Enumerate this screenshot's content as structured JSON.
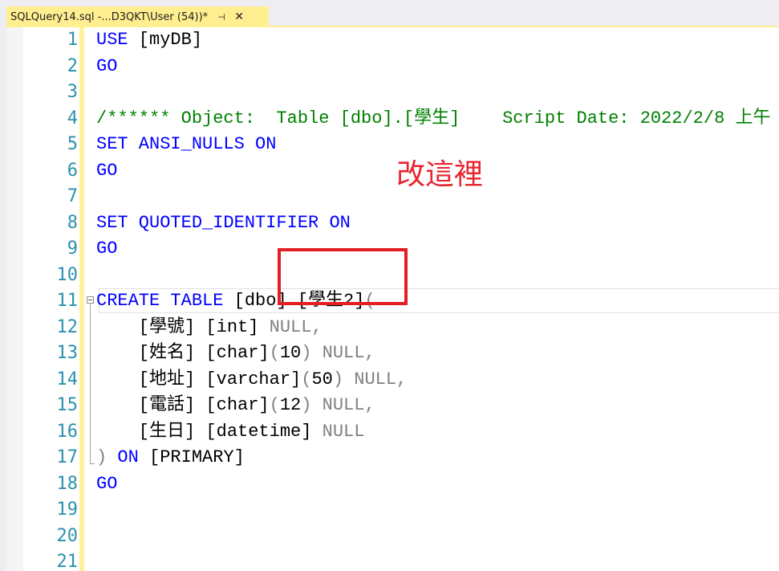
{
  "tab": {
    "title": "SQLQuery14.sql -...D3QKT\\User (54))*",
    "pin_glyph": "⊣",
    "close_glyph": "✕",
    "icons": [
      "pin-icon",
      "close-icon"
    ]
  },
  "colors": {
    "tab_active": "#ffef91",
    "keyword": "#0000ff",
    "comment": "#008000",
    "gray": "#808080",
    "line_number": "#2b91af",
    "annotation": "#e8242e"
  },
  "line_numbers": [
    "1",
    "2",
    "3",
    "4",
    "5",
    "6",
    "7",
    "8",
    "9",
    "10",
    "11",
    "12",
    "13",
    "14",
    "15",
    "16",
    "17",
    "18",
    "19",
    "20",
    "21"
  ],
  "code": {
    "l1_kw": "USE",
    "l1_rest": " [myDB]",
    "l2_kw": "GO",
    "l4_comment": "/****** Object:  Table [dbo].[學生]    Script Date: 2022/2/8 上午",
    "l5_kw": "SET ANSI_NULLS ON",
    "l6_kw": "GO",
    "l8_kw": "SET QUOTED_IDENTIFIER ON",
    "l9_kw": "GO",
    "l11_kw": "CREATE TABLE",
    "l11_dbo": " [dbo]",
    "l11_dot": ".",
    "l11_table": "[學生2]",
    "l11_paren": "(",
    "l12_col": "    [學號] [int] ",
    "l12_null": "NULL,",
    "l13_col": "    [姓名] [char]",
    "l13_p1": "(",
    "l13_num": "10",
    "l13_p2": ") NULL,",
    "l14_col": "    [地址] [varchar]",
    "l14_p1": "(",
    "l14_num": "50",
    "l14_p2": ") NULL,",
    "l15_col": "    [電話] [char]",
    "l15_p1": "(",
    "l15_num": "12",
    "l15_p2": ") NULL,",
    "l16_col": "    [生日] [datetime] ",
    "l16_null": "NULL",
    "l17_paren": ")",
    "l17_kw": " ON",
    "l17_rest": " [PRIMARY]",
    "l18_kw": "GO"
  },
  "annotation_text": "改這裡"
}
